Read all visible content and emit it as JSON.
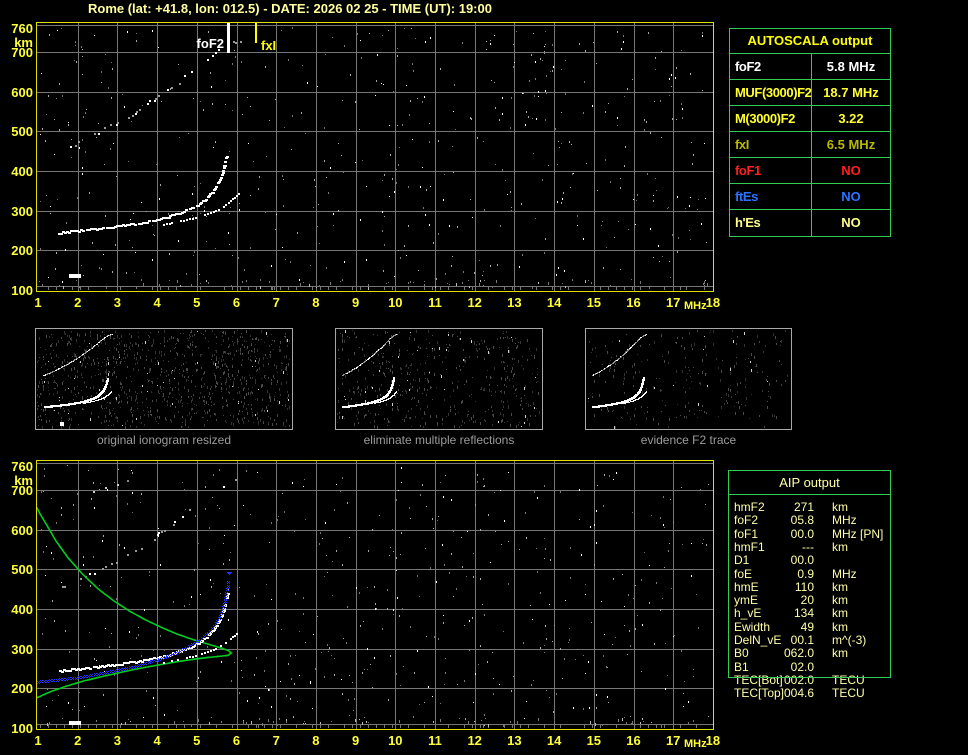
{
  "title": "Rome (lat: +41.8, lon: 012.5) - DATE: 2026 02 25 - TIME (UT): 19:00",
  "colors": {
    "background": "#000000",
    "title_text": "#ffff9e",
    "axis_text": "#ffff38",
    "plot_border": "#e0e000",
    "grid": "#767676",
    "table_border": "#33cc55",
    "autoscala_header": "#ffff00",
    "aip_text": "#ffffa8",
    "caption_text": "#9b9b9b",
    "trace_white": "#ffffff",
    "trace_noise": "#9a9a9a",
    "trace_blue": "#2233ff",
    "profile_green": "#00cc22",
    "marker_foF2": "#ffffff",
    "marker_fxI": "#ffff00"
  },
  "plots": {
    "y_unit": "km",
    "x_unit": "MHz",
    "y_ticks": [
      760,
      700,
      600,
      500,
      400,
      300,
      200,
      100
    ],
    "x_ticks": [
      1,
      2,
      3,
      4,
      5,
      6,
      7,
      8,
      9,
      10,
      11,
      12,
      13,
      14,
      15,
      16,
      17,
      18
    ],
    "top_markers": [
      {
        "label": "foF2",
        "freq": 5.8
      },
      {
        "label": "fxI",
        "freq": 6.5
      }
    ]
  },
  "autoscala": {
    "header": "AUTOSCALA output",
    "rows": [
      {
        "param": "foF2",
        "value": "5.8 MHz",
        "color": "#ffffff"
      },
      {
        "param": "MUF(3000)F2",
        "value": "18.7 MHz",
        "color": "#ffff2e"
      },
      {
        "param": "M(3000)F2",
        "value": "3.22",
        "color": "#ffff2e"
      },
      {
        "param": "fxI",
        "value": "6.5 MHz",
        "color": "#b9b900"
      },
      {
        "param": "foF1",
        "value": "NO",
        "color": "#ff1f1f"
      },
      {
        "param": "ftEs",
        "value": "NO",
        "color": "#2d72ff"
      },
      {
        "param": "h'Es",
        "value": "NO",
        "color": "#ffff8c"
      }
    ]
  },
  "thumbnails": [
    {
      "caption": "original ionogram resized"
    },
    {
      "caption": "eliminate multiple reflections"
    },
    {
      "caption": "evidence F2 trace"
    }
  ],
  "aip": {
    "header": "AIP output",
    "rows": [
      {
        "param": "hmF2",
        "value": "271",
        "unit": "km",
        "extra": ""
      },
      {
        "param": "foF2",
        "value": "05.8",
        "unit": "MHz",
        "extra": ""
      },
      {
        "param": "foF1",
        "value": "00.0",
        "unit": "MHz",
        "extra": "[PN]"
      },
      {
        "param": "hmF1",
        "value": "---",
        "unit": "km",
        "extra": ""
      },
      {
        "param": "D1",
        "value": "00.0",
        "unit": "",
        "extra": ""
      },
      {
        "param": "foE",
        "value": "0.9",
        "unit": "MHz",
        "extra": ""
      },
      {
        "param": "hmE",
        "value": "110",
        "unit": "km",
        "extra": ""
      },
      {
        "param": "ymE",
        "value": "20",
        "unit": "km",
        "extra": ""
      },
      {
        "param": "h_vE",
        "value": "134",
        "unit": "km",
        "extra": ""
      },
      {
        "param": "Ewidth",
        "value": "49",
        "unit": "km",
        "extra": ""
      },
      {
        "param": "DelN_vE",
        "value": "00.1",
        "unit": "m^(-3)",
        "extra": ""
      },
      {
        "param": "B0",
        "value": "062.0",
        "unit": "km",
        "extra": ""
      },
      {
        "param": "B1",
        "value": "02.0",
        "unit": "",
        "extra": ""
      },
      {
        "param": "TEC[Bot]",
        "value": "002.0",
        "unit": "TECU",
        "extra": ""
      },
      {
        "param": "TEC[Top]",
        "value": "004.6",
        "unit": "TECU",
        "extra": ""
      }
    ]
  },
  "chart_data": {
    "type": "scatter",
    "title": "ionogram (virtual height vs sounding frequency)",
    "xlabel": "MHz",
    "ylabel": "km",
    "x_range": [
      1,
      18
    ],
    "y_range": [
      100,
      760
    ],
    "grid": true,
    "f2_trace": [
      [
        1.55,
        243
      ],
      [
        1.9,
        247
      ],
      [
        2.3,
        251
      ],
      [
        2.7,
        256
      ],
      [
        3.1,
        261
      ],
      [
        3.5,
        267
      ],
      [
        3.9,
        274
      ],
      [
        4.2,
        281
      ],
      [
        4.5,
        290
      ],
      [
        4.8,
        301
      ],
      [
        5.05,
        314
      ],
      [
        5.25,
        329
      ],
      [
        5.42,
        347
      ],
      [
        5.55,
        368
      ],
      [
        5.65,
        392
      ],
      [
        5.72,
        415
      ],
      [
        5.77,
        437
      ]
    ],
    "x_branch": [
      [
        4.15,
        266
      ],
      [
        4.45,
        271
      ],
      [
        4.75,
        277
      ],
      [
        5.05,
        285
      ],
      [
        5.35,
        295
      ],
      [
        5.6,
        307
      ],
      [
        5.8,
        321
      ],
      [
        5.95,
        334
      ],
      [
        6.05,
        344
      ]
    ],
    "second_hop": [
      [
        1.5,
        452
      ],
      [
        1.9,
        468
      ],
      [
        2.3,
        486
      ],
      [
        2.7,
        506
      ],
      [
        3.1,
        528
      ],
      [
        3.5,
        552
      ],
      [
        3.9,
        578
      ],
      [
        4.3,
        606
      ],
      [
        4.7,
        636
      ],
      [
        5.0,
        660
      ],
      [
        5.3,
        684
      ],
      [
        5.55,
        706
      ],
      [
        5.8,
        722
      ],
      [
        6.1,
        730
      ]
    ],
    "high_spread_dots": [
      [
        1.9,
        670
      ],
      [
        2.1,
        680
      ],
      [
        2.4,
        695
      ],
      [
        2.7,
        705
      ],
      [
        3.0,
        715
      ],
      [
        3.25,
        725
      ]
    ],
    "blue_scaled_trace": [
      [
        1.0,
        208
      ],
      [
        1.4,
        212
      ],
      [
        1.8,
        216
      ],
      [
        2.2,
        222
      ],
      [
        2.6,
        229
      ],
      [
        3.0,
        237
      ],
      [
        3.4,
        246
      ],
      [
        3.8,
        257
      ],
      [
        4.2,
        270
      ],
      [
        4.6,
        286
      ],
      [
        4.9,
        302
      ],
      [
        5.15,
        318
      ],
      [
        5.35,
        336
      ],
      [
        5.5,
        356
      ],
      [
        5.62,
        380
      ],
      [
        5.7,
        405
      ],
      [
        5.76,
        432
      ],
      [
        5.8,
        458
      ]
    ],
    "blue_top_marker": [
      5.82,
      490
    ],
    "green_profile": [
      [
        0.97,
        176
      ],
      [
        1.3,
        191
      ],
      [
        1.7,
        205
      ],
      [
        2.1,
        217
      ],
      [
        2.5,
        227
      ],
      [
        2.9,
        236
      ],
      [
        3.3,
        245
      ],
      [
        3.7,
        253
      ],
      [
        4.1,
        260
      ],
      [
        4.5,
        267
      ],
      [
        4.9,
        273
      ],
      [
        5.3,
        278
      ],
      [
        5.6,
        281
      ],
      [
        5.78,
        283
      ],
      [
        5.87,
        289
      ],
      [
        5.8,
        295
      ],
      [
        5.6,
        302
      ],
      [
        5.3,
        311
      ],
      [
        4.9,
        323
      ],
      [
        4.5,
        337
      ],
      [
        4.1,
        354
      ],
      [
        3.7,
        373
      ],
      [
        3.3,
        395
      ],
      [
        2.9,
        421
      ],
      [
        2.5,
        452
      ],
      [
        2.1,
        490
      ],
      [
        1.75,
        530
      ],
      [
        1.45,
        572
      ],
      [
        1.2,
        615
      ],
      [
        1.05,
        640
      ],
      [
        0.97,
        656
      ]
    ],
    "es_dash_top": [
      1.8,
      2.12,
      133
    ],
    "es_dash_bottom": [
      1.8,
      2.12,
      112
    ],
    "thumb_dash": [
      2.6,
      140
    ],
    "noise": {
      "main_plot": 520,
      "bottom_strip": 70,
      "thumbs": [
        1000,
        480,
        250
      ]
    },
    "foF2_MHz": 5.8,
    "fxI_MHz": 6.5,
    "hmF2_km": 271
  }
}
